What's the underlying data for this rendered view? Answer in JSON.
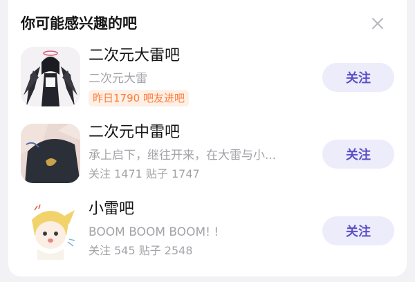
{
  "panel": {
    "title": "你可能感兴趣的吧",
    "close_icon": "close-icon"
  },
  "forums": [
    {
      "name": "二次元大雷吧",
      "description": "二次元大雷",
      "badge": "昨日1790 吧友进吧",
      "follow_label": "关注",
      "avatar": "anime-girl-dark-wings-avatar"
    },
    {
      "name": "二次元中雷吧",
      "description": "承上启下，继往开来，在大雷与小...",
      "stats": "关注 1471 贴子 1747",
      "follow_label": "关注",
      "avatar": "anime-dress-closeup-avatar"
    },
    {
      "name": "小雷吧",
      "description": "BOOM BOOM BOOM! !",
      "stats": "关注 545 贴子 2548",
      "follow_label": "关注",
      "avatar": "chibi-blonde-character-avatar"
    }
  ],
  "colors": {
    "accent": "#5b4fc9",
    "button_bg": "#ececfb",
    "badge_text": "#ff7a38",
    "badge_bg": "#fff0e6"
  }
}
